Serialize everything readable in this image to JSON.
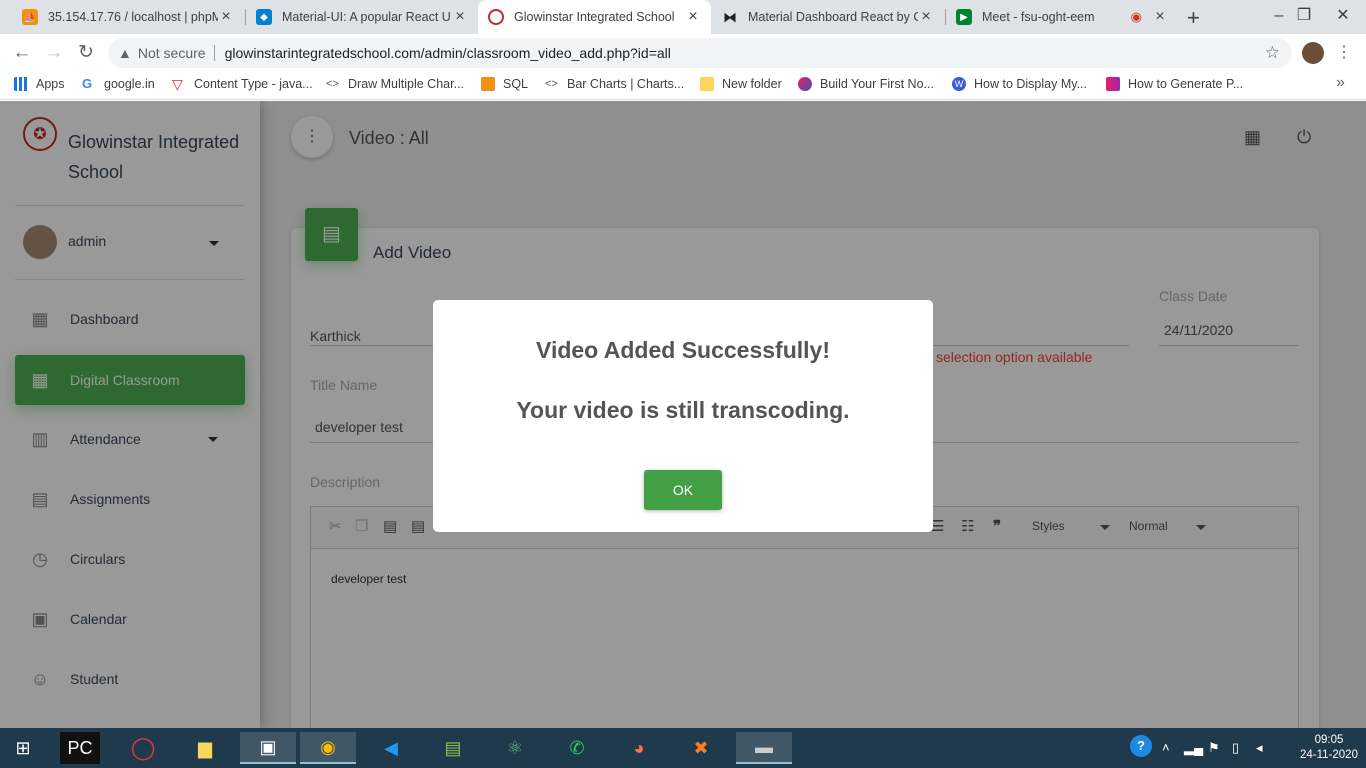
{
  "browser": {
    "tabs": [
      {
        "title": "35.154.17.76 / localhost | phpMyAdmin"
      },
      {
        "title": "Material-UI: A popular React UI framework"
      },
      {
        "title": "Glowinstar Integrated School"
      },
      {
        "title": "Material Dashboard React by Creative Tim"
      },
      {
        "title": "Meet - fsu-oght-eem"
      }
    ],
    "address": {
      "security_label": "Not secure",
      "url": "glowinstarintegratedschool.com/admin/classroom_video_add.php?id=all"
    },
    "bookmarks": [
      {
        "label": "Apps"
      },
      {
        "label": "google.in"
      },
      {
        "label": "Content Type - java..."
      },
      {
        "label": "Draw Multiple Char..."
      },
      {
        "label": "SQL"
      },
      {
        "label": "Bar Charts | Charts..."
      },
      {
        "label": "New folder"
      },
      {
        "label": "Build Your First No..."
      },
      {
        "label": "How to Display My..."
      },
      {
        "label": "How to Generate P..."
      }
    ]
  },
  "sidebar": {
    "school_name": "Glowinstar Integrated School",
    "user": "admin",
    "items": [
      {
        "label": "Dashboard"
      },
      {
        "label": "Digital Classroom"
      },
      {
        "label": "Attendance"
      },
      {
        "label": "Assignments"
      },
      {
        "label": "Circulars"
      },
      {
        "label": "Calendar"
      },
      {
        "label": "Student"
      }
    ]
  },
  "header": {
    "title": "Video : All"
  },
  "form": {
    "card_title": "Add Video",
    "teacher_value": "Karthick",
    "class_date_label": "Class Date",
    "class_date_value": "24/11/2020",
    "error_text": "selection option available",
    "title_label": "Title Name",
    "title_value": "developer test",
    "description_label": "Description",
    "editor_styles": "Styles",
    "editor_format": "Normal",
    "editor_content": "developer test"
  },
  "modal": {
    "line1": "Video Added Successfully!",
    "line2": "Your video is still transcoding.",
    "ok_label": "OK"
  },
  "taskbar": {
    "time": "09:05",
    "date": "24-11-2020"
  },
  "colors": {
    "accent_green": "#4caf50",
    "error_red": "#f44336"
  }
}
